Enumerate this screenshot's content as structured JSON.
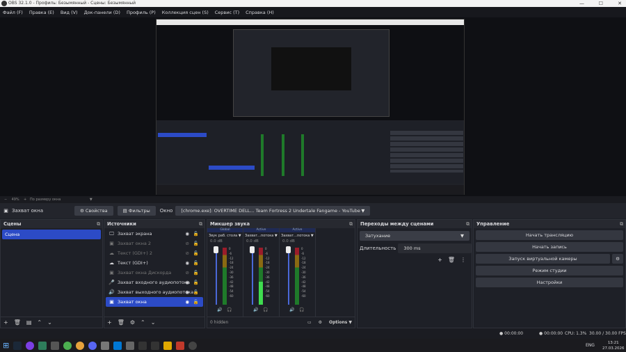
{
  "window": {
    "title": "OBS 32.1.0 - Профиль: Безымянный - Сцены: Безымянный"
  },
  "menu": [
    "Файл (F)",
    "Правка (E)",
    "Вид (V)",
    "Док-панели (D)",
    "Профиль (P)",
    "Коллекция сцен (S)",
    "Сервис (T)",
    "Справка (H)"
  ],
  "zoom": {
    "value": "49%",
    "label": "По размеру окна"
  },
  "toolbar": {
    "source": "Захват окна",
    "properties": "Свойства",
    "filters": "Фильтры",
    "window_label": "Окно",
    "window_value": "[chrome.exe]: OVERTIME DELL... Team Fortress 2 Undertale Fangame - YouTube - Google Chror"
  },
  "scenes": {
    "title": "Сцены",
    "items": [
      "Сцена"
    ]
  },
  "sources": {
    "title": "Источники",
    "items": [
      {
        "name": "Захват экрана",
        "icon": "monitor-icon",
        "visible": true
      },
      {
        "name": "Захват окна 2",
        "icon": "window-icon",
        "visible": false
      },
      {
        "name": "Текст (GDI+) 2",
        "icon": "text-icon",
        "visible": false
      },
      {
        "name": "Текст (GDI+)",
        "icon": "text-icon",
        "visible": true
      },
      {
        "name": "Захват окна Дискорда",
        "icon": "window-icon",
        "visible": false
      },
      {
        "name": "Захват входного аудиопотока",
        "icon": "mic-icon",
        "visible": true
      },
      {
        "name": "Захват выходного аудиопотока",
        "icon": "speaker-icon",
        "visible": true
      },
      {
        "name": "Захват окна",
        "icon": "window-icon",
        "visible": true
      }
    ]
  },
  "mixer": {
    "title": "Микшер звука",
    "channels": [
      {
        "tag": "Global",
        "name": "Звук раб. стола",
        "db": "0.0 dB"
      },
      {
        "tag": "Active",
        "name": "Захват...потока",
        "db": "0.0 dB"
      },
      {
        "tag": "Active",
        "name": "Захват...потока",
        "db": "0.0 dB"
      }
    ],
    "scale": [
      "0",
      "-6",
      "-12",
      "-18",
      "-24",
      "-30",
      "-36",
      "-42",
      "-48",
      "-54",
      "-60"
    ],
    "hidden": "0 hidden",
    "options": "Options"
  },
  "transitions": {
    "title": "Переходы между сценами",
    "selected": "Затухание",
    "duration_label": "Длительность",
    "duration": "300 ms"
  },
  "controls": {
    "title": "Управление",
    "buttons": [
      "Начать трансляцию",
      "Начать запись",
      "Запуск виртуальной камеры",
      "Режим студии",
      "Настройки"
    ]
  },
  "status": {
    "stream_time": "00:00:00",
    "rec_time": "00:00:00",
    "cpu": "CPU: 1.3%",
    "fps": "30.00 / 30.00 FPS"
  },
  "taskbar": {
    "lang": "ENG",
    "time": "13:21",
    "date": "27.03.2026"
  }
}
